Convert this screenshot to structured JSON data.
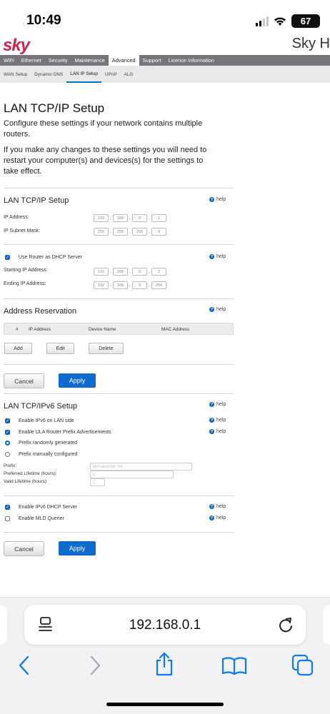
{
  "status_bar": {
    "time": "10:49",
    "battery": "67"
  },
  "header": {
    "logo": "sky",
    "brand_right": "Sky H"
  },
  "main_nav": [
    "WiFi",
    "Ethernet",
    "Security",
    "Maintenance",
    "Advanced",
    "Support",
    "Licence Information"
  ],
  "main_nav_active": "Advanced",
  "sub_nav": [
    "WAN Setup",
    "Dynamic DNS",
    "LAN IP Setup",
    "UPnP",
    "ALG"
  ],
  "sub_nav_active": "LAN IP Setup",
  "page": {
    "title": "LAN TCP/IP Setup",
    "intro1": "Configure these settings if your network contains multiple routers.",
    "intro2": "If you make any changes to these settings you will need to restart your computer(s) and devices(s) for the settings to take effect.",
    "help_label": "help"
  },
  "lan": {
    "section_title": "LAN TCP/IP Setup",
    "ip_label": "IP Address:",
    "ip": [
      "192",
      "168",
      "0",
      "1"
    ],
    "mask_label": "IP Subnet Mask:",
    "mask": [
      "255",
      "255",
      "255",
      "0"
    ],
    "dhcp_label": "Use Router as DHCP Server",
    "start_label": "Starting IP Address:",
    "start_ip": [
      "192",
      "168",
      "0",
      "2"
    ],
    "end_label": "Ending IP Address:",
    "end_ip": [
      "192",
      "168",
      "0",
      "254"
    ]
  },
  "reservation": {
    "title": "Address Reservation",
    "columns": [
      "#",
      "IP Address",
      "Device Name",
      "MAC Address"
    ],
    "add_label": "Add",
    "edit_label": "Edit",
    "delete_label": "Delete"
  },
  "buttons": {
    "cancel": "Cancel",
    "apply": "Apply"
  },
  "ipv6": {
    "title": "LAN TCP/IPv6 Setup",
    "enable_lan": "Enable IPv6 on LAN side",
    "enable_ula": "Enable ULA Router Prefix Advertisements",
    "prefix_random": "Prefix randomly generated",
    "prefix_manual": "Prefix manually configured",
    "prefix_label": "Prefix:",
    "prefix_placeholder": "fde0:abcd:0ab::/64",
    "preferred_label": "Preferred Lifetime (hours):",
    "valid_label": "Valid Lifetime (hours):",
    "lifetime_value": "1",
    "dhcp_label": "Enable IPv6 DHCP Server",
    "mld_label": "Enable MLD Querier"
  },
  "browser": {
    "url": "192.168.0.1"
  }
}
